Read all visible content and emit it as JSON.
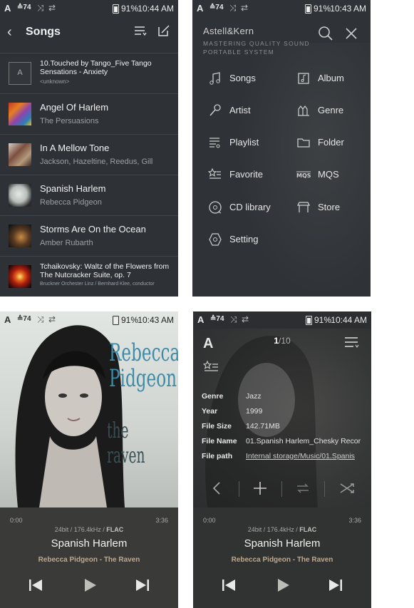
{
  "status_left": {
    "logo": "A",
    "volume": "74"
  },
  "status": [
    {
      "battery": "91%",
      "time": "10:44 AM"
    },
    {
      "battery": "91%",
      "time": "10:43 AM"
    },
    {
      "battery": "91%",
      "time": "10:43 AM"
    },
    {
      "battery": "91%",
      "time": "10:44 AM"
    }
  ],
  "songs_screen": {
    "title": "Songs",
    "items": [
      {
        "title": "10.Touched by Tango_Five Tango Sensations - Anxiety",
        "artist": "<unknown>",
        "thumb_letter": "A"
      },
      {
        "title": "Angel Of Harlem",
        "artist": "The Persuasions"
      },
      {
        "title": "In A Mellow Tone",
        "artist": "Jackson, Hazeltine, Reedus, Gill"
      },
      {
        "title": "Spanish Harlem",
        "artist": "Rebecca Pidgeon"
      },
      {
        "title": "Storms Are On the Ocean",
        "artist": "Amber Rubarth"
      },
      {
        "title": "Tchaikovsky: Waltz of the Flowers from The Nutcracker Suite, op. 7",
        "artist": "Bruckner Orchester Linz / Bernhard Klee, conductor"
      }
    ]
  },
  "menu_screen": {
    "brand": "Astell&Kern",
    "tagline": "MASTERING QUALITY SOUND PORTABLE SYSTEM",
    "items": [
      {
        "label": "Songs",
        "icon": "music-note-icon"
      },
      {
        "label": "Album",
        "icon": "album-icon"
      },
      {
        "label": "Artist",
        "icon": "microphone-icon"
      },
      {
        "label": "Genre",
        "icon": "genre-icon"
      },
      {
        "label": "Playlist",
        "icon": "playlist-icon"
      },
      {
        "label": "Folder",
        "icon": "folder-icon"
      },
      {
        "label": "Favorite",
        "icon": "favorite-icon"
      },
      {
        "label": "MQS",
        "icon": "mqs-icon"
      },
      {
        "label": "CD library",
        "icon": "cd-icon"
      },
      {
        "label": "Store",
        "icon": "store-icon"
      },
      {
        "label": "Setting",
        "icon": "settings-hexagon-icon"
      }
    ]
  },
  "player_screen": {
    "cover_artist": "Rebecca Pidgeon",
    "cover_album": "the raven",
    "time_elapsed": "0:00",
    "time_total": "3:36",
    "quality_prefix": "24bit / 176.4kHz /",
    "quality_format": "FLAC",
    "track": "Spanish Harlem",
    "artist_album": "Rebecca Pidgeon - The Raven"
  },
  "info_screen": {
    "logo": "A",
    "page_current": "1",
    "page_total": "/10",
    "fields": [
      {
        "label": "Genre",
        "value": "Jazz"
      },
      {
        "label": "Year",
        "value": "1999"
      },
      {
        "label": "File Size",
        "value": "142.71MB"
      },
      {
        "label": "File Name",
        "value": "01.Spanish Harlem_Chesky Recor"
      },
      {
        "label": "File path",
        "value": "Internal storage/Music/01.Spanis"
      }
    ],
    "time_elapsed": "0:00",
    "time_total": "3:36",
    "quality_prefix": "24bit / 176.4kHz /",
    "quality_format": "FLAC",
    "track": "Spanish Harlem",
    "artist_album": "Rebecca Pidgeon - The Raven"
  }
}
